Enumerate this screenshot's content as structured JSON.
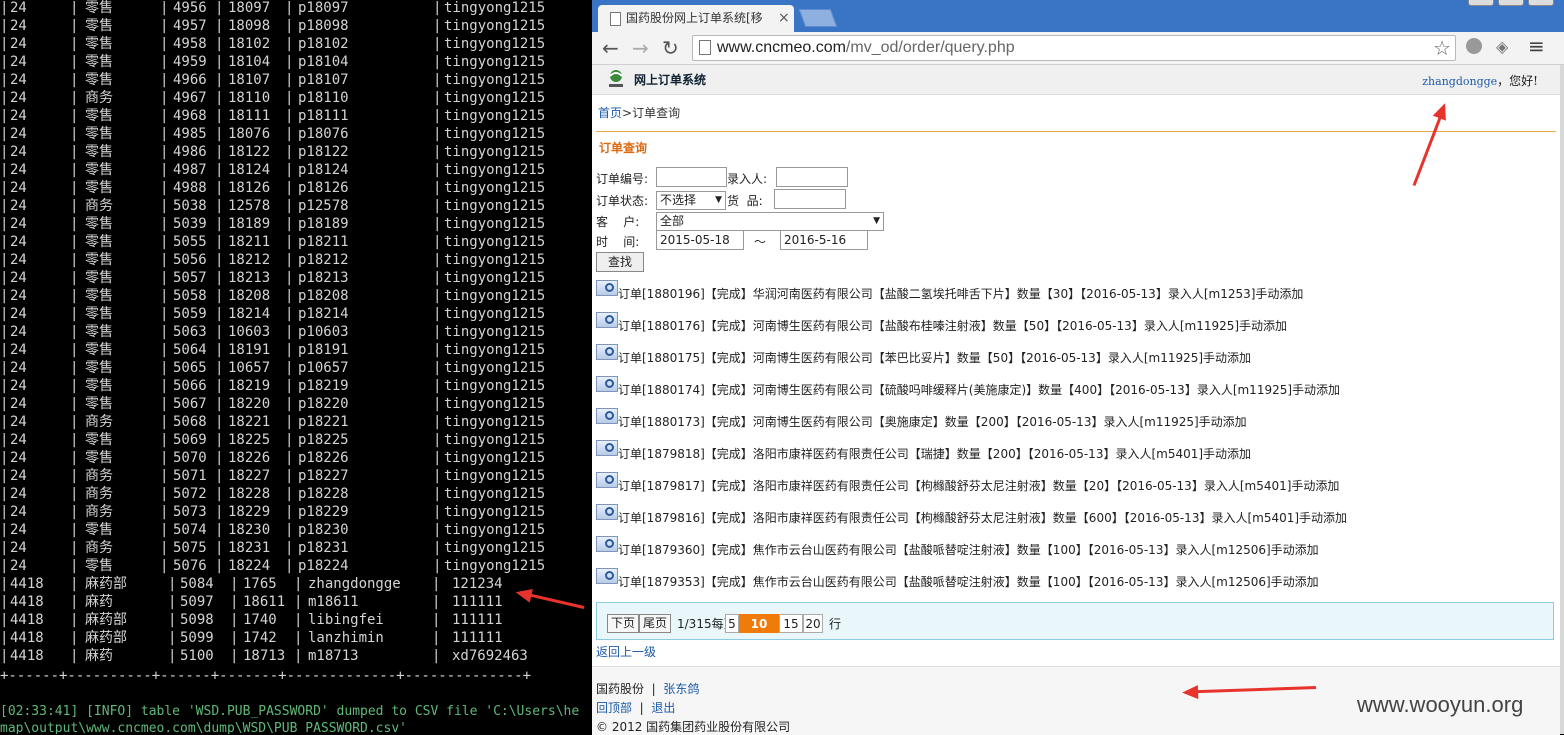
{
  "terminal": {
    "rows": [
      [
        "24",
        "零售",
        "4956",
        "18097",
        "p18097",
        "tingyong1215"
      ],
      [
        "24",
        "零售",
        "4957",
        "18098",
        "p18098",
        "tingyong1215"
      ],
      [
        "24",
        "零售",
        "4958",
        "18102",
        "p18102",
        "tingyong1215"
      ],
      [
        "24",
        "零售",
        "4959",
        "18104",
        "p18104",
        "tingyong1215"
      ],
      [
        "24",
        "零售",
        "4966",
        "18107",
        "p18107",
        "tingyong1215"
      ],
      [
        "24",
        "商务",
        "4967",
        "18110",
        "p18110",
        "tingyong1215"
      ],
      [
        "24",
        "零售",
        "4968",
        "18111",
        "p18111",
        "tingyong1215"
      ],
      [
        "24",
        "零售",
        "4985",
        "18076",
        "p18076",
        "tingyong1215"
      ],
      [
        "24",
        "零售",
        "4986",
        "18122",
        "p18122",
        "tingyong1215"
      ],
      [
        "24",
        "零售",
        "4987",
        "18124",
        "p18124",
        "tingyong1215"
      ],
      [
        "24",
        "零售",
        "4988",
        "18126",
        "p18126",
        "tingyong1215"
      ],
      [
        "24",
        "商务",
        "5038",
        "12578",
        "p12578",
        "tingyong1215"
      ],
      [
        "24",
        "零售",
        "5039",
        "18189",
        "p18189",
        "tingyong1215"
      ],
      [
        "24",
        "零售",
        "5055",
        "18211",
        "p18211",
        "tingyong1215"
      ],
      [
        "24",
        "零售",
        "5056",
        "18212",
        "p18212",
        "tingyong1215"
      ],
      [
        "24",
        "零售",
        "5057",
        "18213",
        "p18213",
        "tingyong1215"
      ],
      [
        "24",
        "零售",
        "5058",
        "18208",
        "p18208",
        "tingyong1215"
      ],
      [
        "24",
        "零售",
        "5059",
        "18214",
        "p18214",
        "tingyong1215"
      ],
      [
        "24",
        "零售",
        "5063",
        "10603",
        "p10603",
        "tingyong1215"
      ],
      [
        "24",
        "零售",
        "5064",
        "18191",
        "p18191",
        "tingyong1215"
      ],
      [
        "24",
        "零售",
        "5065",
        "10657",
        "p10657",
        "tingyong1215"
      ],
      [
        "24",
        "零售",
        "5066",
        "18219",
        "p18219",
        "tingyong1215"
      ],
      [
        "24",
        "零售",
        "5067",
        "18220",
        "p18220",
        "tingyong1215"
      ],
      [
        "24",
        "商务",
        "5068",
        "18221",
        "p18221",
        "tingyong1215"
      ],
      [
        "24",
        "零售",
        "5069",
        "18225",
        "p18225",
        "tingyong1215"
      ],
      [
        "24",
        "零售",
        "5070",
        "18226",
        "p18226",
        "tingyong1215"
      ],
      [
        "24",
        "商务",
        "5071",
        "18227",
        "p18227",
        "tingyong1215"
      ],
      [
        "24",
        "商务",
        "5072",
        "18228",
        "p18228",
        "tingyong1215"
      ],
      [
        "24",
        "商务",
        "5073",
        "18229",
        "p18229",
        "tingyong1215"
      ],
      [
        "24",
        "零售",
        "5074",
        "18230",
        "p18230",
        "tingyong1215"
      ],
      [
        "24",
        "商务",
        "5075",
        "18231",
        "p18231",
        "tingyong1215"
      ],
      [
        "24",
        "零售",
        "5076",
        "18224",
        "p18224",
        "tingyong1215"
      ],
      [
        "4418",
        "麻药部",
        "5084",
        "1765",
        "zhangdongge",
        "121234"
      ],
      [
        "4418",
        "麻药",
        "5097",
        "18611",
        "m18611",
        "111111"
      ],
      [
        "4418",
        "麻药部",
        "5098",
        "1740",
        "libingfei",
        "111111"
      ],
      [
        "4418",
        "麻药部",
        "5099",
        "1742",
        "lanzhimin",
        "111111"
      ],
      [
        "4418",
        "麻药",
        "5100",
        "18713",
        "m18713",
        "xd7692463"
      ]
    ],
    "separator": "+------+----------+------+-------+-------------+--------------+",
    "log_line_1": "[02:33:41] [INFO] table 'WSD.PUB_PASSWORD' dumped to CSV file 'C:\\Users\\he",
    "log_line_2": "map\\output\\www.cncmeo.com\\dump\\WSD\\PUB_PASSWORD.csv'"
  },
  "browser": {
    "tab_title": "国药股份网上订单系统[移",
    "tab_close": "×",
    "url_host": "www.cncmeo.com",
    "url_path": "/mv_od/order/query.php",
    "icons": {
      "back": "←",
      "forward": "→",
      "reload": "↻",
      "star": "☆",
      "shield": "◈",
      "menu": "≡"
    }
  },
  "app": {
    "title": "网上订单系统",
    "greeting_user": "zhangdongge",
    "greeting_suffix": "，您好!",
    "breadcrumb_home": "首页",
    "breadcrumb_sep": ">",
    "breadcrumb_current": "订单查询",
    "section_title": "订单查询"
  },
  "form": {
    "order_no_label": "订单编号:",
    "entered_by_label": "录入人:",
    "status_label": "订单状态:",
    "status_value": "不选择",
    "goods_label": "货  品:",
    "customer_label": "客    户:",
    "customer_value": "全部",
    "time_label": "时    间:",
    "date_from": "2015-05-18",
    "date_sep": "～",
    "date_to": "2016-5-16",
    "search_button": "查找"
  },
  "results": [
    "订单[1880196]【完成】华润河南医药有限公司【盐酸二氢埃托啡舌下片】数量【30】【2016-05-13】录入人[m1253]手动添加",
    "订单[1880176]【完成】河南博生医药有限公司【盐酸布桂嗪注射液】数量【50】【2016-05-13】录入人[m11925]手动添加",
    "订单[1880175]【完成】河南博生医药有限公司【苯巴比妥片】数量【50】【2016-05-13】录入人[m11925]手动添加",
    "订单[1880174]【完成】河南博生医药有限公司【硫酸吗啡缓释片(美施康定)】数量【400】【2016-05-13】录入人[m11925]手动添加",
    "订单[1880173]【完成】河南博生医药有限公司【奥施康定】数量【200】【2016-05-13】录入人[m11925]手动添加",
    "订单[1879818]【完成】洛阳市康祥医药有限责任公司【瑞捷】数量【200】【2016-05-13】录入人[m5401]手动添加",
    "订单[1879817]【完成】洛阳市康祥医药有限责任公司【枸橼酸舒芬太尼注射液】数量【20】【2016-05-13】录入人[m5401]手动添加",
    "订单[1879816]【完成】洛阳市康祥医药有限责任公司【枸橼酸舒芬太尼注射液】数量【600】【2016-05-13】录入人[m5401]手动添加",
    "订单[1879360]【完成】焦作市云台山医药有限公司【盐酸哌替啶注射液】数量【100】【2016-05-13】录入人[m12506]手动添加",
    "订单[1879353]【完成】焦作市云台山医药有限公司【盐酸哌替啶注射液】数量【100】【2016-05-13】录入人[m12506]手动添加"
  ],
  "pager": {
    "next": "下页",
    "last": "尾页",
    "info": "1/315每页",
    "sizes": [
      "5",
      "10",
      "15",
      "20"
    ],
    "selected": "10",
    "suffix": "行"
  },
  "footer": {
    "back_link": "返回上一级",
    "company": "国药股份",
    "sep": "|",
    "user_name": "张东鸽",
    "back_dept": "回顶部",
    "logout": "退出",
    "copyright": "© 2012 国药集团药业股份有限公司"
  },
  "watermark": "www.wooyun.org",
  "colors": {
    "annotation_arrow": "#e8332d",
    "tabbar": "#3a74c4",
    "accent_orange": "#f07a0a"
  }
}
